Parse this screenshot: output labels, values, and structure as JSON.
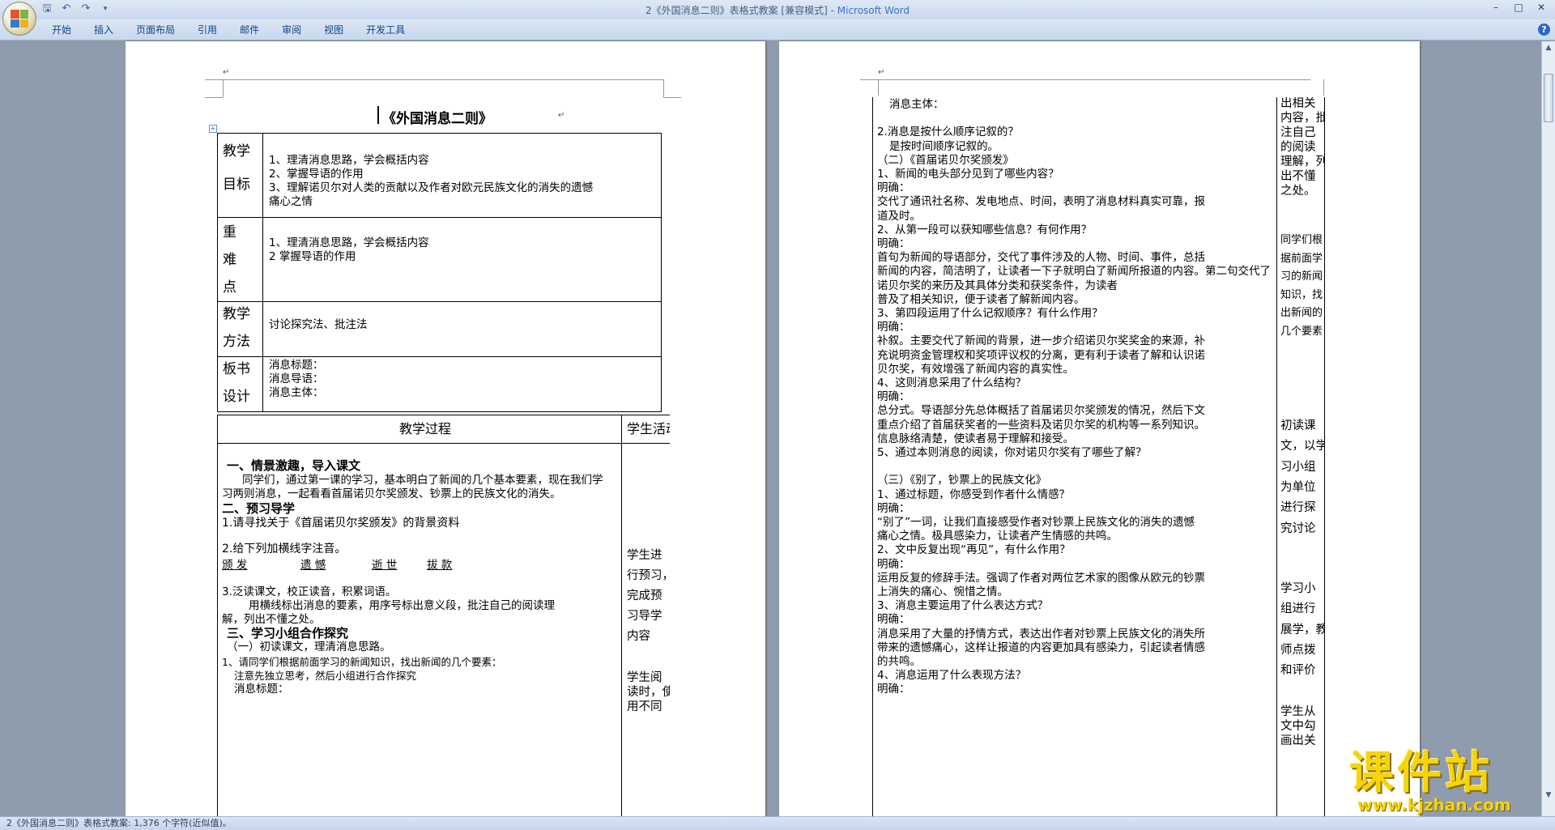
{
  "window": {
    "title_doc": "2《外国消息二则》表格式教案 [兼容模式] - ",
    "title_app": "Microsoft Word"
  },
  "ribbon": {
    "tabs": [
      "开始",
      "插入",
      "页面布局",
      "引用",
      "邮件",
      "审阅",
      "视图",
      "开发工具"
    ]
  },
  "icons": {
    "save": "save-icon",
    "undo": "undo-icon",
    "redo": "redo-icon",
    "help": "help-icon"
  },
  "page1": {
    "title": "《外国消息二则》",
    "rows": {
      "objectives": {
        "label1": "教学",
        "label2": "目标",
        "lines": [
          "1、理清消息思路，学会概括内容",
          "2、掌握导语的作用",
          "3、理解诺贝尔对人类的贡献以及作者对欧元民族文化的消失的遗憾",
          "痛心之情"
        ]
      },
      "key_points": {
        "label1": "重",
        "label2": "难",
        "label3": "点",
        "lines": [
          "1、理清消息思路，学会概括内容",
          "2 掌握导语的作用"
        ]
      },
      "method": {
        "label1": "教学",
        "label2": "方法",
        "text": "讨论探究法、批注法"
      },
      "board": {
        "label1": "板书",
        "label2": "设计",
        "lines": [
          "消息标题：",
          "消息导语：",
          "消息主体："
        ]
      }
    },
    "process_header": "教学过程",
    "student_header": "学生活动",
    "process": {
      "h1": "一、情景激趣，导入课文",
      "p1a": "同学们，通过第一课的学习，基本明白了新闻的几个基本要素，现在我们学",
      "p1b": "习两则消息，一起看看首届诺贝尔奖颁发、钞票上的民族文化的消失。",
      "h2": "二、预习导学",
      "q1": "1.请寻找关于《首届诺贝尔奖颁发》的背景资料",
      "q2": "2.给下列加横线字注音。",
      "words": [
        "颁 发",
        "遗 憾",
        "逝 世",
        "拔 款"
      ],
      "q3": "3.泛读课文，校正读音，积累词语。",
      "q3b": "用横线标出消息的要素，用序号标出意义段，批注自己的阅读理",
      "q3c": "解，列出不懂之处。",
      "h3": "三、学习小组合作探究",
      "s1": "（一）初读课文，理清消息思路。",
      "s1a": "1、请同学们根据前面学习的新闻知识，找出新闻的几个要素：",
      "s1b": "注意先独立思考，然后小组进行合作探究",
      "s1c": "消息标题："
    },
    "student": [
      "学生进",
      "行预习，",
      "完成预",
      "习导学",
      "内容",
      "学生阅",
      "读时，使",
      "用不同"
    ]
  },
  "page2": {
    "main_lines": [
      "消息主体：",
      "",
      "2.消息是按什么顺序记叙的？",
      "是按时间顺序记叙的。",
      "（二）《首届诺贝尔奖颁发》",
      "1、新闻的电头部分见到了哪些内容？",
      "明确：",
      "交代了通讯社名称、发电地点、时间，表明了消息材料真实可靠，报",
      "道及时。",
      "2、从第一段可以获知哪些信息？有何作用？",
      "明确：",
      "首句为新闻的导语部分，交代了事件涉及的人物、时间、事件，总括",
      "新闻的内容，简洁明了，让读者一下子就明白了新闻所报道的内容。第二句交代了诺贝尔奖的来历及其具体分类和获奖条件，为读者",
      "普及了相关知识，便于读者了解新闻内容。",
      "3、第四段运用了什么记叙顺序？有什么作用？",
      "明确：",
      "补叙。主要交代了新闻的背景，进一步介绍诺贝尔奖奖金的来源，补",
      "充说明资金管理权和奖项评议权的分离，更有利于读者了解和认识诺",
      "贝尔奖，有效增强了新闻内容的真实性。",
      "4、这则消息采用了什么结构？",
      "明确：",
      "总分式。导语部分先总体概括了首届诺贝尔奖颁发的情况，然后下文",
      "重点介绍了首届获奖者的一些资料及诺贝尔奖的机构等一系列知识。",
      "信息脉络清楚，使读者易于理解和接受。",
      "5、通过本则消息的阅读，你对诺贝尔奖有了哪些了解？",
      "",
      "（三）《别了，钞票上的民族文化》",
      "1、通过标题，你感受到作者什么情感？",
      "明确：",
      "“别了”一词，让我们直接感受作者对钞票上民族文化的消失的遗憾",
      "痛心之情。极具感染力，让读者产生情感的共鸣。",
      "2、文中反复出现“再见”，有什么作用？",
      "明确：",
      "运用反复的修辞手法。强调了作者对两位艺术家的图像从欧元的钞票",
      "上消失的痛心、惋惜之情。",
      "3、消息主要运用了什么表达方式？",
      "明确：",
      "消息采用了大量的抒情方式，表达出作者对钞票上民族文化的消失所",
      "带来的遗憾痛心，这样让报道的内容更加具有感染力，引起读者情感",
      "的共鸣。",
      "4、消息运用了什么表现方法？",
      "明确："
    ],
    "side_top": [
      "出相关",
      "内容，批",
      "注自己",
      "的阅读",
      "理解，列",
      "出不懂",
      "之处。"
    ],
    "side_mid": [
      "同学们根",
      "据前面学",
      "习的新闻",
      "知识，找",
      "出新闻的",
      "几个要素"
    ],
    "side_low": [
      "初读课",
      "文，以学",
      "习小组",
      "为单位",
      "进行探",
      "究讨论"
    ],
    "side_bottom": [
      "学习小",
      "组进行",
      "展学，教",
      "师点拨",
      "和评价",
      "学生从",
      "文中勾",
      "画出关"
    ]
  },
  "status_bar": {
    "text": "2《外国消息二则》表格式教案: 1,376 个字符(近似值)。"
  },
  "watermark": {
    "main": "课件站",
    "url": "www.kjzhan.com"
  }
}
